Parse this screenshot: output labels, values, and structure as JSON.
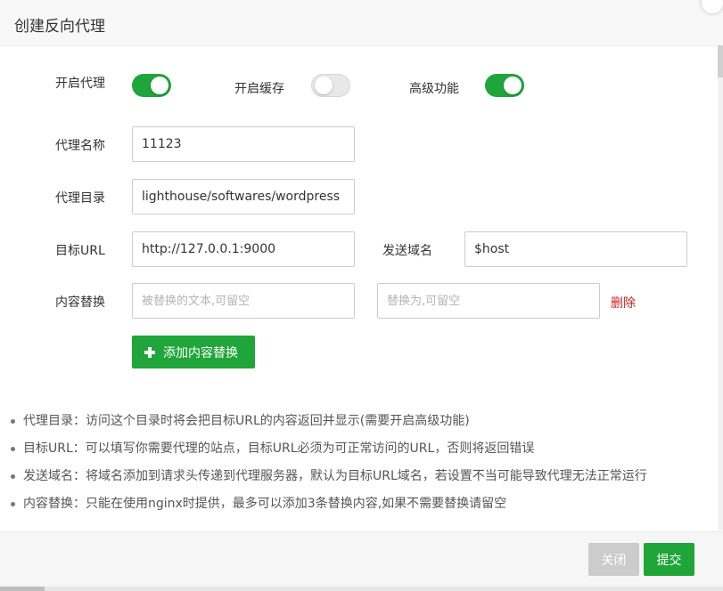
{
  "dialog": {
    "title": "创建反向代理"
  },
  "toggles": [
    {
      "label": "开启代理",
      "on": true
    },
    {
      "label": "开启缓存",
      "on": false
    },
    {
      "label": "高级功能",
      "on": true
    }
  ],
  "form": {
    "proxy_name": {
      "label": "代理名称",
      "value": "11123"
    },
    "proxy_dir": {
      "label": "代理目录",
      "value": "lighthouse/softwares/wordpress"
    },
    "target_url": {
      "label": "目标URL",
      "value": "http://127.0.0.1:9000"
    },
    "send_domain": {
      "label": "发送域名",
      "value": "$host"
    },
    "content_replace": {
      "label": "内容替换",
      "from_placeholder": "被替换的文本,可留空",
      "to_placeholder": "替换为,可留空",
      "delete_label": "删除"
    },
    "add_replace_label": "添加内容替换"
  },
  "help": [
    "代理目录：访问这个目录时将会把目标URL的内容返回并显示(需要开启高级功能)",
    "目标URL：可以填写你需要代理的站点，目标URL必须为可正常访问的URL，否则将返回错误",
    "发送域名：将域名添加到请求头传递到代理服务器，默认为目标URL域名，若设置不当可能导致代理无法正常运行",
    "内容替换：只能在使用nginx时提供，最多可以添加3条替换内容,如果不需要替换请留空"
  ],
  "footer": {
    "close_label": "关闭",
    "submit_label": "提交"
  },
  "colors": {
    "accent": "#20a53a",
    "danger": "#cc2222",
    "disabled": "#cccccc"
  }
}
